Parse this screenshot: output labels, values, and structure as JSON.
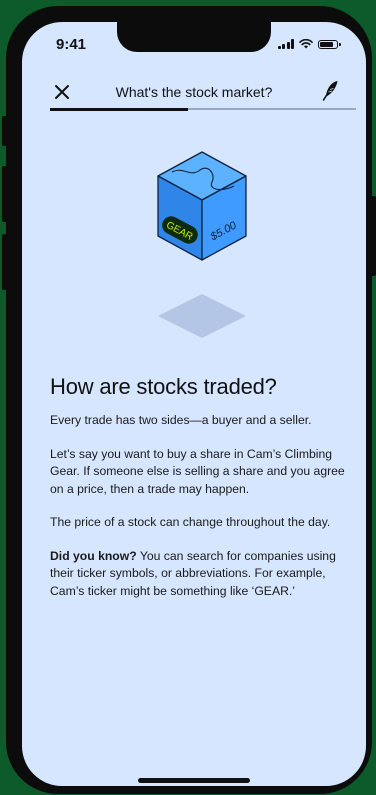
{
  "status_bar": {
    "time": "9:41"
  },
  "nav": {
    "title": "What's the stock market?",
    "progress": 0.45
  },
  "illustration": {
    "ticker": "GEAR",
    "price": "$5.00"
  },
  "content": {
    "heading": "How are stocks traded?",
    "para1": "Every trade has two sides—a buyer and a seller.",
    "para2": "Let’s say you want to buy a share in Cam’s Climbing Gear. If someone else is selling a share and you agree on a price, then a trade may happen.",
    "para3": "The price of a stock can change throughout the day.",
    "did_you_know_label": "Did you know?",
    "para4": " You can search for companies using their ticker symbols, or abbreviations. For example, Cam’s ticker might be something like ‘GEAR.’"
  },
  "colors": {
    "screen_bg": "#d6e6ff",
    "cube_top": "#5cb2ff",
    "cube_left": "#2f86e8",
    "cube_right": "#3f9bff",
    "badge": "#0d2a12",
    "badge_text": "#c8f000",
    "shadow": "#b3c6e6"
  }
}
